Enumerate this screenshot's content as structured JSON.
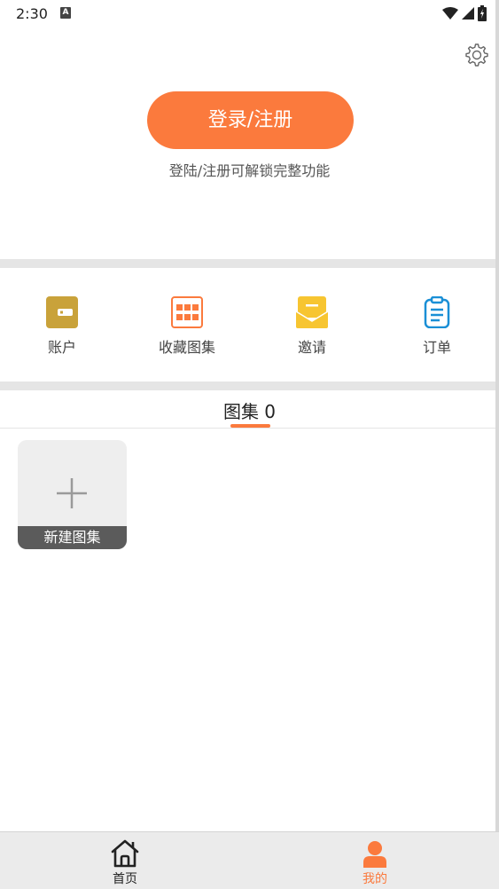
{
  "status_bar": {
    "time": "2:30",
    "notification_letter": "A"
  },
  "header": {
    "login_button_label": "登录/注册",
    "login_hint": "登陆/注册可解锁完整功能"
  },
  "shortcuts": [
    {
      "label": "账户",
      "icon": "wallet-icon",
      "color": "#c9a23a"
    },
    {
      "label": "收藏图集",
      "icon": "grid-collection-icon",
      "color": "#fb7a3d"
    },
    {
      "label": "邀请",
      "icon": "mail-icon",
      "color": "#f7c531"
    },
    {
      "label": "订单",
      "icon": "clipboard-icon",
      "color": "#1a8fd6"
    }
  ],
  "gallery_tab": {
    "label": "图集 0"
  },
  "new_album": {
    "label": "新建图集"
  },
  "bottom_nav": {
    "items": [
      {
        "label": "首页",
        "icon": "home-icon",
        "active": false
      },
      {
        "label": "我的",
        "icon": "profile-icon",
        "active": true
      }
    ],
    "active_color": "#fb7a3d"
  }
}
